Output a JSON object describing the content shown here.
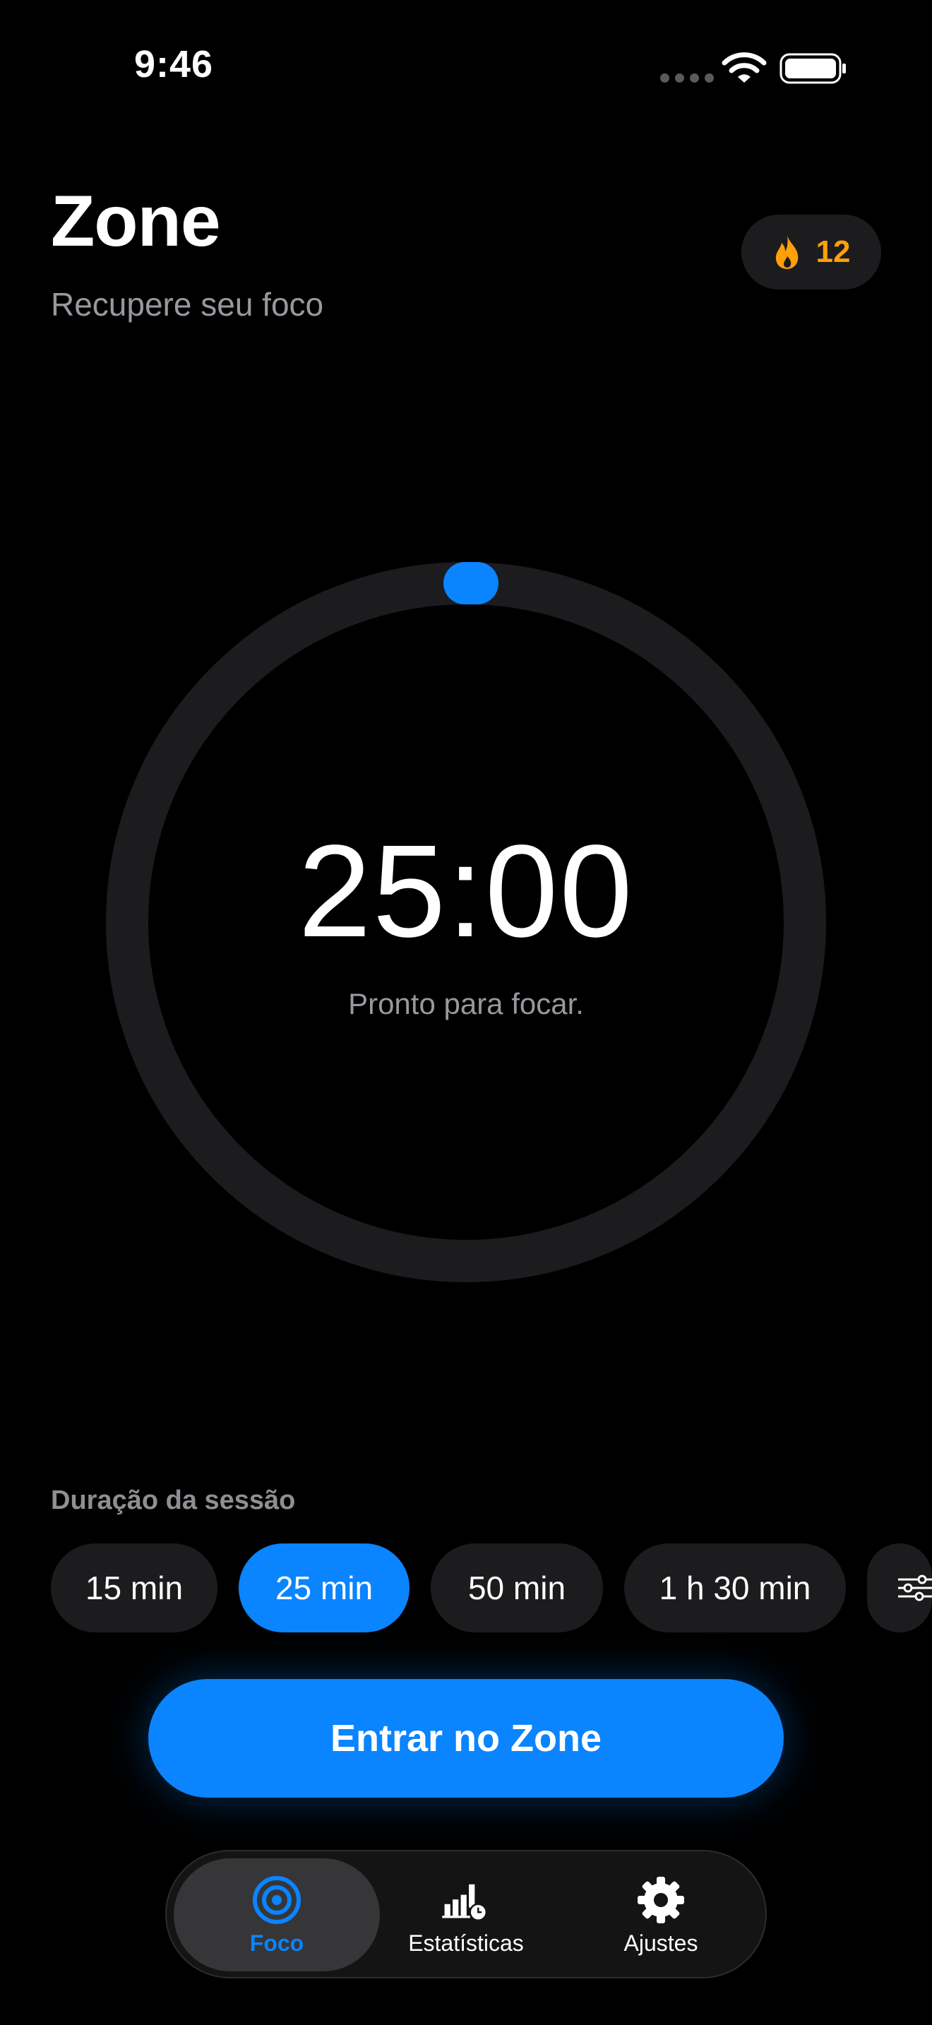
{
  "status_bar": {
    "time": "9:46",
    "icons": [
      "cellular-signal-icon",
      "wifi-icon",
      "battery-icon"
    ]
  },
  "header": {
    "title": "Zone",
    "subtitle": "Recupere seu foco",
    "streak": {
      "icon": "flame-icon",
      "count": "12",
      "color": "#ff9f0a"
    }
  },
  "timer": {
    "value": "25:00",
    "status": "Pronto para focar.",
    "progress": 0,
    "ring_color": "#1c1c1e",
    "handle_color": "#0a84ff"
  },
  "duration": {
    "label": "Duração da sessão",
    "options": [
      {
        "label": "15 min",
        "selected": false
      },
      {
        "label": "25 min",
        "selected": true
      },
      {
        "label": "50 min",
        "selected": false
      },
      {
        "label": "1 h 30 min",
        "selected": false
      }
    ],
    "custom_icon": "sliders-icon"
  },
  "cta": {
    "label": "Entrar no Zone"
  },
  "tabbar": {
    "tabs": [
      {
        "label": "Foco",
        "icon": "target-icon",
        "active": true
      },
      {
        "label": "Estatísticas",
        "icon": "chart-clock-icon",
        "active": false
      },
      {
        "label": "Ajustes",
        "icon": "gear-icon",
        "active": false
      }
    ]
  },
  "colors": {
    "accent": "#0a84ff",
    "background": "#000000",
    "surface": "#1c1c1e",
    "secondary_text": "#98989e"
  }
}
